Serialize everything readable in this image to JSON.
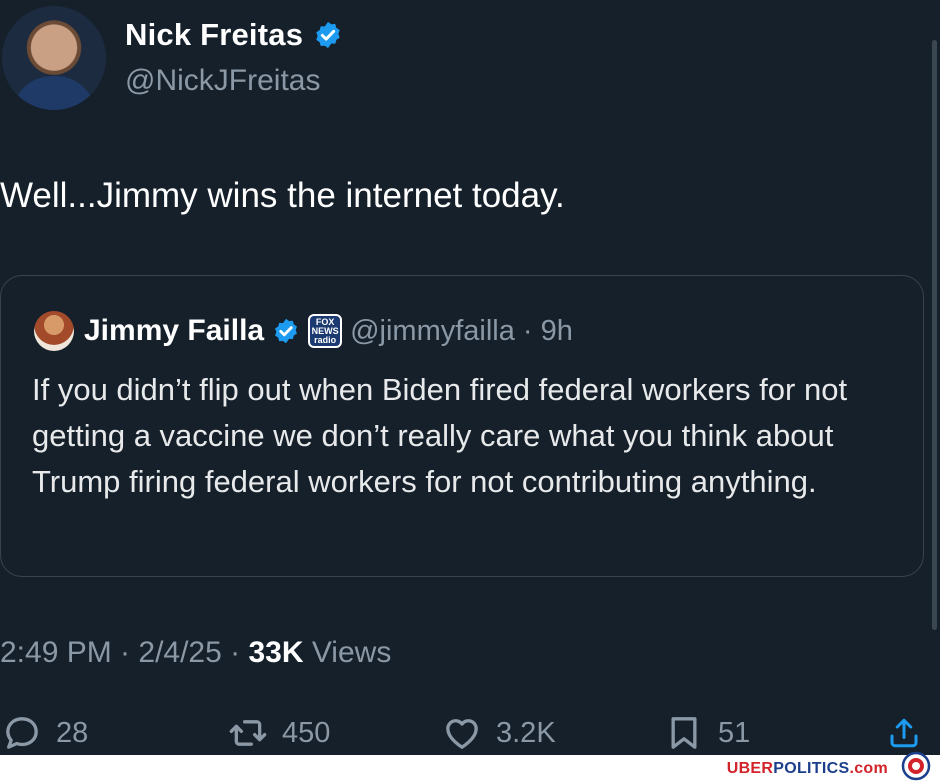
{
  "tweet": {
    "author_name": "Nick Freitas",
    "author_handle": "@NickJFreitas",
    "text": "Well...Jimmy wins the internet today.",
    "quoted": {
      "author_name": "Jimmy Failla",
      "affiliation_badge_text": "FOX NEWS radio",
      "handle_time": "@jimmyfailla · 9h",
      "text": "If you didn’t flip out when Biden fired federal workers for not getting a vaccine we don’t really care what you think about Trump firing federal workers for not contributing anything."
    },
    "timestamp": "2:49 PM · 2/4/25 · ",
    "views_count": "33K",
    "views_label": " Views",
    "actions": {
      "replies": "28",
      "reposts": "450",
      "likes": "3.2K",
      "bookmarks": "51"
    }
  },
  "watermark": {
    "uber": "UBER",
    "politics": "POLITICS",
    "com": ".com"
  },
  "colors": {
    "background": "#15202b",
    "verified_blue": "#1d9bf0",
    "secondary_text": "#8b98a5"
  }
}
